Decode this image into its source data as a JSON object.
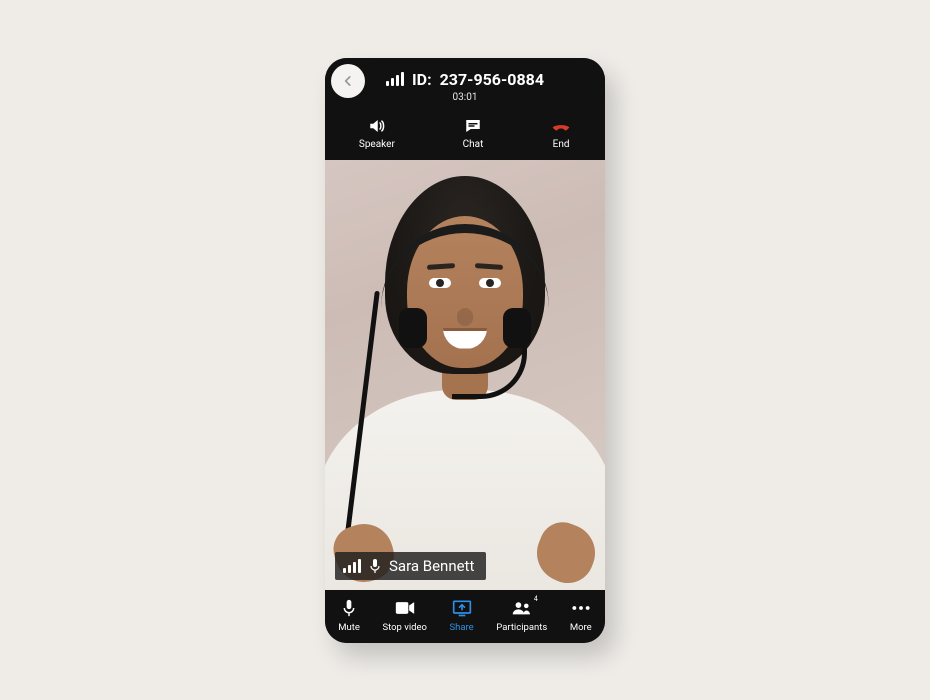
{
  "header": {
    "id_prefix": "ID:",
    "id_value": "237-956-0884",
    "timer": "03:01"
  },
  "top_actions": {
    "speaker": "Speaker",
    "chat": "Chat",
    "end": "End"
  },
  "participant": {
    "name": "Sara Bennett"
  },
  "bottom_actions": {
    "mute": "Mute",
    "stop_video": "Stop video",
    "share": "Share",
    "participants": "Participants",
    "participants_count": "4",
    "more": "More"
  },
  "colors": {
    "end_call": "#d83a2a",
    "share_active": "#2e8fe6"
  }
}
